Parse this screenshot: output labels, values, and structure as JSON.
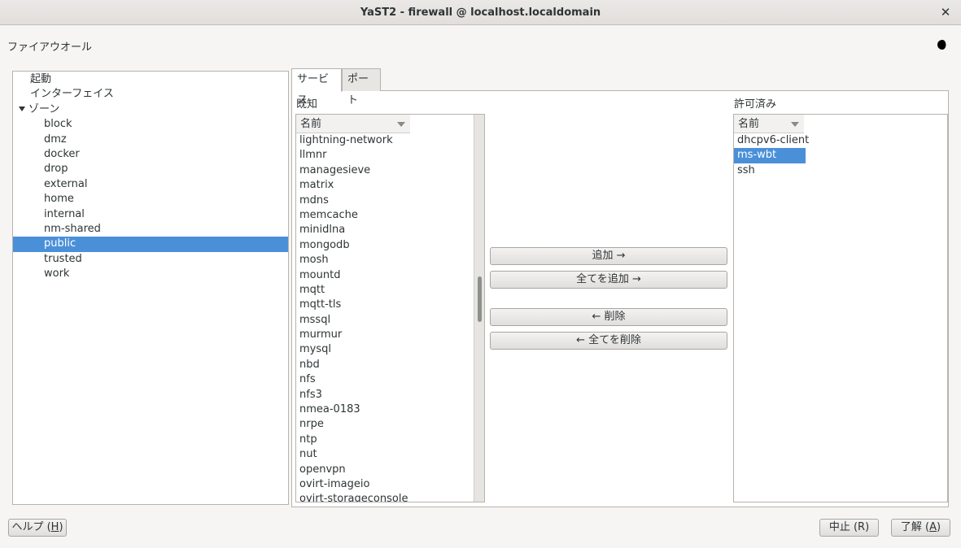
{
  "window": {
    "title": "YaST2 - firewall @ localhost.localdomain",
    "close_glyph": "✕"
  },
  "heading": "ファイアウオール",
  "icons": {
    "theme": "moon-icon",
    "expander": "triangle-down-icon"
  },
  "tree": {
    "items": [
      {
        "label": "起動",
        "level": 0
      },
      {
        "label": "インターフェイス",
        "level": 0
      },
      {
        "label": "ゾーン",
        "level": 0,
        "expanded": true
      },
      {
        "label": "block",
        "level": 1
      },
      {
        "label": "dmz",
        "level": 1
      },
      {
        "label": "docker",
        "level": 1
      },
      {
        "label": "drop",
        "level": 1
      },
      {
        "label": "external",
        "level": 1
      },
      {
        "label": "home",
        "level": 1
      },
      {
        "label": "internal",
        "level": 1
      },
      {
        "label": "nm-shared",
        "level": 1
      },
      {
        "label": "public",
        "level": 1,
        "selected": true
      },
      {
        "label": "trusted",
        "level": 1
      },
      {
        "label": "work",
        "level": 1
      }
    ]
  },
  "tabs": [
    {
      "label": "サービス",
      "active": true
    },
    {
      "label": "ポート",
      "active": false
    }
  ],
  "known": {
    "label": "既知",
    "column": "名前",
    "items": [
      "lightning-network",
      "llmnr",
      "managesieve",
      "matrix",
      "mdns",
      "memcache",
      "minidlna",
      "mongodb",
      "mosh",
      "mountd",
      "mqtt",
      "mqtt-tls",
      "mssql",
      "murmur",
      "mysql",
      "nbd",
      "nfs",
      "nfs3",
      "nmea-0183",
      "nrpe",
      "ntp",
      "nut",
      "openvpn",
      "ovirt-imageio",
      "ovirt-storageconsole"
    ]
  },
  "allowed": {
    "label": "許可済み",
    "column": "名前",
    "items": [
      {
        "label": "dhcpv6-client",
        "selected": false
      },
      {
        "label": "ms-wbt",
        "selected": true
      },
      {
        "label": "ssh",
        "selected": false
      }
    ]
  },
  "actions": {
    "add": "追加 →",
    "add_all": "全てを追加 →",
    "remove": "← 削除",
    "remove_all": "← 全てを削除"
  },
  "footer": {
    "help_prefix": "ヘルプ (",
    "help_key": "H",
    "help_suffix": ")",
    "cancel_prefix": "中止 (R)",
    "ok_prefix": "了解 (",
    "ok_key": "A",
    "ok_suffix": ")"
  },
  "colors": {
    "selection": "#4a90d9",
    "window_bg": "#f6f5f4"
  }
}
